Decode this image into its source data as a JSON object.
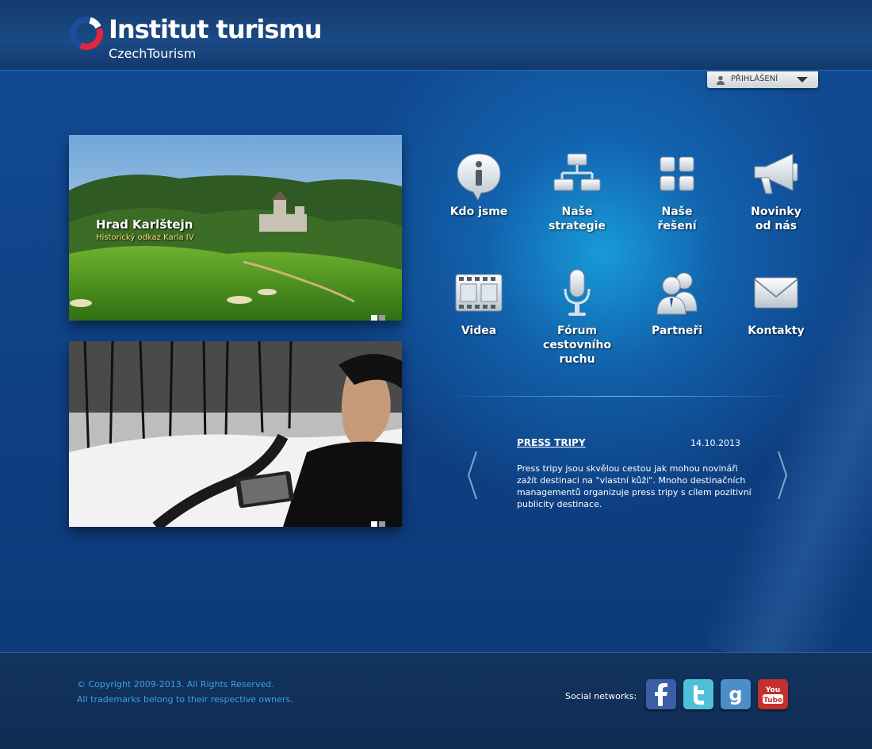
{
  "header": {
    "logo_title": "Institut turismu",
    "logo_subtitle": "CzechTourism"
  },
  "login": {
    "label": "PŘIHLÁŠENÍ"
  },
  "slides": [
    {
      "title": "Hrad Karlštejn",
      "subtitle": "Historický odkaz Karla IV",
      "active_dot": 1,
      "dot_count": 2
    },
    {
      "active_dot": 1,
      "dot_count": 2
    }
  ],
  "tiles": [
    {
      "label_lines": [
        "Kdo jsme"
      ],
      "icon": "info-icon"
    },
    {
      "label_lines": [
        "Naše",
        "strategie"
      ],
      "icon": "sitemap-icon"
    },
    {
      "label_lines": [
        "Naše",
        "řešení"
      ],
      "icon": "grid-icon"
    },
    {
      "label_lines": [
        "Novinky",
        "od nás"
      ],
      "icon": "megaphone-icon"
    },
    {
      "label_lines": [
        "Videa"
      ],
      "icon": "film-icon"
    },
    {
      "label_lines": [
        "Fórum",
        "cestovního",
        "ruchu"
      ],
      "icon": "microphone-icon"
    },
    {
      "label_lines": [
        "Partneři"
      ],
      "icon": "people-icon"
    },
    {
      "label_lines": [
        "Kontakty"
      ],
      "icon": "envelope-icon"
    }
  ],
  "news": {
    "title": "PRESS TRIPY",
    "date": "14.10.2013",
    "text": "Press tripy jsou skvělou cestou jak mohou novináři zažít destinaci na \"vlastní kůži\". Mnoho destinačních managementů organizuje press tripy s cílem pozitivní publicity destinace."
  },
  "footer": {
    "copyright_line1": "© Copyright 2009-2013. All Rights Reserved.",
    "copyright_line2": "All trademarks belong to their respective owners.",
    "social_label": "Social networks:",
    "social": [
      "facebook-icon",
      "twitter-icon",
      "google-icon",
      "youtube-icon"
    ]
  },
  "colors": {
    "accent_link": "#3aa3e0",
    "slide_subtitle": "#f3e27a"
  }
}
